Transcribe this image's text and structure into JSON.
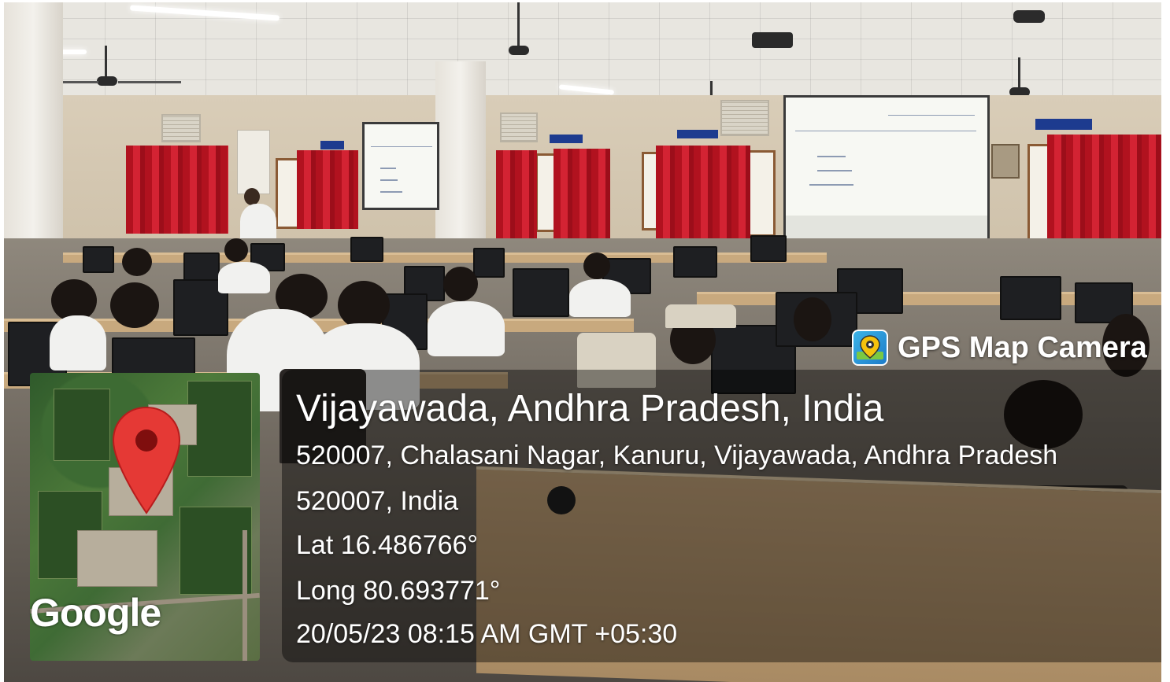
{
  "watermark": {
    "app_name": "GPS Map Camera",
    "app_icon": "map-pin-camera-icon",
    "map_attribution": "Google"
  },
  "location": {
    "title": "Vijayawada, Andhra Pradesh, India",
    "address_line_1": "520007, Chalasani Nagar, Kanuru, Vijayawada, Andhra Pradesh",
    "address_line_2": "520007, India",
    "latitude": "Lat 16.486766°",
    "longitude": "Long 80.693771°",
    "timestamp": "20/05/23 08:15 AM GMT +05:30"
  },
  "colors": {
    "pin": "#e53935",
    "overlay": "rgba(0,0,0,0.42)",
    "text": "#ffffff"
  }
}
